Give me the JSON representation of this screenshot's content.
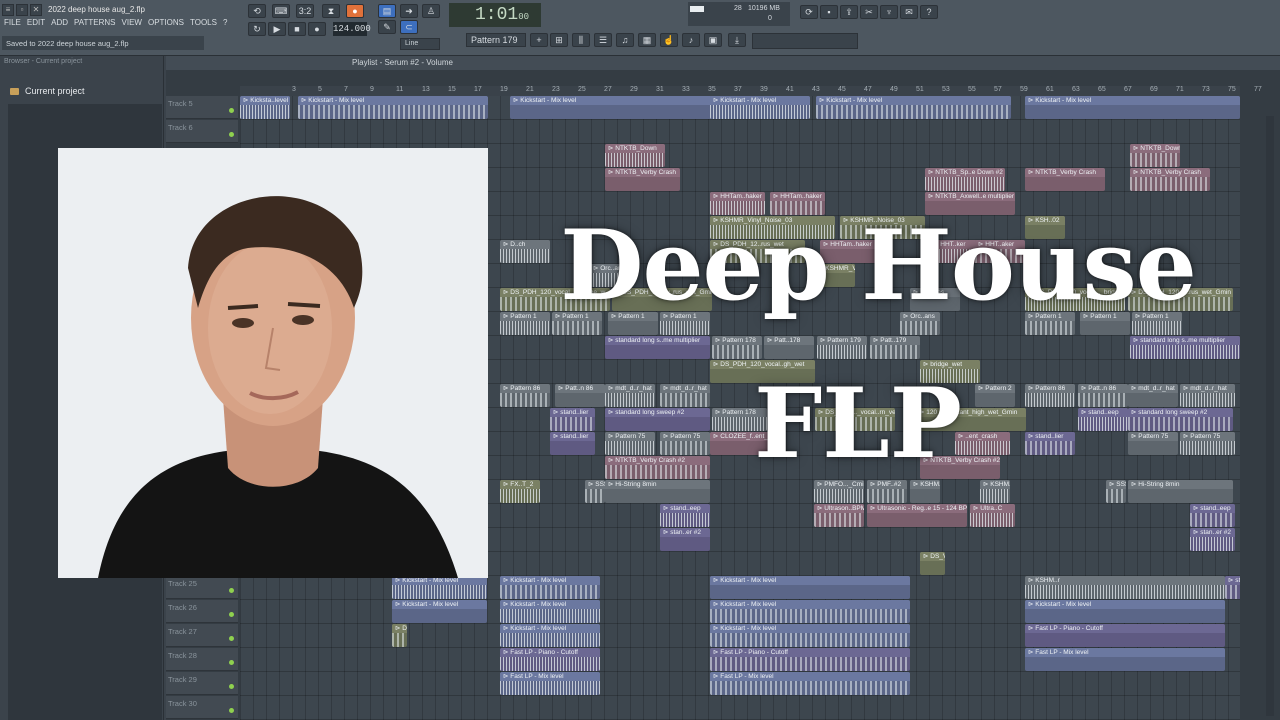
{
  "window": {
    "file_title": "2022 deep house aug_2.flp",
    "hint": "Saved to 2022 deep house aug_2.flp"
  },
  "menu": [
    "FILE",
    "EDIT",
    "ADD",
    "PATTERNS",
    "VIEW",
    "OPTIONS",
    "TOOLS",
    "?"
  ],
  "transport": {
    "time": "1:01",
    "time_sub": "00",
    "tempo": "124.000",
    "pattern": "Pattern 179",
    "snap": "Line",
    "time_sig": "3:2"
  },
  "cpu": {
    "left": "28",
    "mem": "10196 MB",
    "voices": "0"
  },
  "browser": {
    "header": "Browser - Current project",
    "item": "Current project"
  },
  "playlist": {
    "title": "Playlist - Serum #2 - Volume",
    "ruler": [
      "3",
      "5",
      "7",
      "9",
      "11",
      "13",
      "15",
      "17",
      "19",
      "21",
      "23",
      "25",
      "27",
      "29",
      "31",
      "33",
      "35",
      "37",
      "39",
      "41",
      "43",
      "45",
      "47",
      "49",
      "51",
      "53",
      "55",
      "57",
      "59",
      "61",
      "63",
      "65",
      "67",
      "69",
      "71",
      "73",
      "75",
      "77"
    ],
    "tracks_top": [
      "Track 5",
      "Track 6"
    ],
    "tracks_bottom": [
      "Track 25",
      "Track 26",
      "Track 27",
      "Track 28",
      "Track 29",
      "Track 30"
    ],
    "clips": [
      {
        "label": "Kicksta..level",
        "color": "c-blue"
      },
      {
        "label": "Kickstart - Mix level",
        "color": "c-blue"
      },
      {
        "label": "Kickstart - Mix level",
        "color": "c-blue"
      },
      {
        "label": "Kickstart - Mix level",
        "color": "c-blue"
      },
      {
        "label": "Kickstart - Mix level",
        "color": "c-blue"
      },
      {
        "label": "Kickstart - Mix level",
        "color": "c-blue"
      },
      {
        "label": "NTKTB_Down",
        "color": "c-pink"
      },
      {
        "label": "NTKTB_Down",
        "color": "c-pink"
      },
      {
        "label": "NTKTB_Verby Crash",
        "color": "c-pink"
      },
      {
        "label": "NTKTB_Sp..e Down #2",
        "color": "c-pink"
      },
      {
        "label": "NTKTB_Verby Crash",
        "color": "c-pink"
      },
      {
        "label": "NTKTB_Verby Crash",
        "color": "c-pink"
      },
      {
        "label": "HHTam..haker",
        "color": "c-pink"
      },
      {
        "label": "HHTam..haker",
        "color": "c-pink"
      },
      {
        "label": "NTKTB_Axwell..e multiplier",
        "color": "c-pink"
      },
      {
        "label": "KSHMR_Vinyl_Noise_03",
        "color": "c-olive"
      },
      {
        "label": "KSHMR..Noise_03",
        "color": "c-olive"
      },
      {
        "label": "KSH..02",
        "color": "c-olive"
      },
      {
        "label": "D..ch",
        "color": "c-gray"
      },
      {
        "label": "DS_PDH_12..rus_wet",
        "color": "c-olive"
      },
      {
        "label": "HHTam..haker",
        "color": "c-pink"
      },
      {
        "label": "HHT..ker",
        "color": "c-pink"
      },
      {
        "label": "HHT..aker",
        "color": "c-pink"
      },
      {
        "label": "KSHMR_V...",
        "color": "c-olive"
      },
      {
        "label": "Orc..ar",
        "color": "c-gray"
      },
      {
        "label": "DS_PDH_120_vocal..._bridge_w",
        "color": "c-olive"
      },
      {
        "label": "DS_PDH_120_v..rus_wet_Gmin",
        "color": "c-olive"
      },
      {
        "label": "DS_PDH_120_vocal..._bridge_w",
        "color": "c-olive"
      },
      {
        "label": "DS_PDH_120_v..rus_wet_Gmin",
        "color": "c-olive"
      },
      {
        "label": "KSH..es",
        "color": "c-gray"
      },
      {
        "label": "Pattern 1",
        "color": "c-gray"
      },
      {
        "label": "Pattern 1",
        "color": "c-gray"
      },
      {
        "label": "Pattern 1",
        "color": "c-gray"
      },
      {
        "label": "Pattern 1",
        "color": "c-gray"
      },
      {
        "label": "Pattern 1",
        "color": "c-gray"
      },
      {
        "label": "Pattern 1",
        "color": "c-gray"
      },
      {
        "label": "Pattern 1",
        "color": "c-gray"
      },
      {
        "label": "Orc..ans",
        "color": "c-gray"
      },
      {
        "label": "standard long s..me multiplier",
        "color": "c-purple"
      },
      {
        "label": "standard long s..me multiplier",
        "color": "c-purple"
      },
      {
        "label": "Pattern 178",
        "color": "c-gray"
      },
      {
        "label": "Patt..178",
        "color": "c-gray"
      },
      {
        "label": "Pattern 179",
        "color": "c-gray"
      },
      {
        "label": "Patt..179",
        "color": "c-gray"
      },
      {
        "label": "DS_PDH_120_vocal..gh_wet",
        "color": "c-olive"
      },
      {
        "label": "bridge_wet",
        "color": "c-olive"
      },
      {
        "label": "Pattern 86",
        "color": "c-gray"
      },
      {
        "label": "Patt..n 86",
        "color": "c-gray"
      },
      {
        "label": "mdt_d..r_hat",
        "color": "c-gray"
      },
      {
        "label": "mdt_d..r_hat",
        "color": "c-gray"
      },
      {
        "label": "Pattern 2",
        "color": "c-gray"
      },
      {
        "label": "Pattern 86",
        "color": "c-gray"
      },
      {
        "label": "Patt..n 86",
        "color": "c-gray"
      },
      {
        "label": "mdt_d..r_hat",
        "color": "c-gray"
      },
      {
        "label": "mdt_d..r_hat",
        "color": "c-gray"
      },
      {
        "label": "stand..lier",
        "color": "c-purple"
      },
      {
        "label": "standard long sweep #2",
        "color": "c-purple"
      },
      {
        "label": "Pattern 178",
        "color": "c-gray"
      },
      {
        "label": "DS_PDH..._vocal..rn_verse",
        "color": "c-olive"
      },
      {
        "label": "120_vocal..ant_high_wet_Gmin",
        "color": "c-olive"
      },
      {
        "label": "stand..eep",
        "color": "c-purple"
      },
      {
        "label": "standard long sweep #2",
        "color": "c-purple"
      },
      {
        "label": "stand..lier",
        "color": "c-purple"
      },
      {
        "label": "Pattern 75",
        "color": "c-gray"
      },
      {
        "label": "Pattern 75",
        "color": "c-gray"
      },
      {
        "label": "CLOZEE_f..ent_cra",
        "color": "c-pink"
      },
      {
        "label": "..ent_crash",
        "color": "c-pink"
      },
      {
        "label": "stand..lier",
        "color": "c-purple"
      },
      {
        "label": "Pattern 75",
        "color": "c-gray"
      },
      {
        "label": "Pattern 75",
        "color": "c-gray"
      },
      {
        "label": "NTKTB_Verby Crash #2",
        "color": "c-pink"
      },
      {
        "label": "NTKTB_Verby Crash #2",
        "color": "c-pink"
      },
      {
        "label": "FX..T_2",
        "color": "c-olive"
      },
      {
        "label": "SSS..",
        "color": "c-gray"
      },
      {
        "label": "Hi-String 8min",
        "color": "c-gray"
      },
      {
        "label": "PMFO..._Cmin",
        "color": "c-gray"
      },
      {
        "label": "PMF..#2",
        "color": "c-gray"
      },
      {
        "label": "KSHM..r",
        "color": "c-gray"
      },
      {
        "label": "KSHM..sic",
        "color": "c-gray"
      },
      {
        "label": "SSS..",
        "color": "c-gray"
      },
      {
        "label": "Hi-String 8min",
        "color": "c-gray"
      },
      {
        "label": "stand..eep",
        "color": "c-purple"
      },
      {
        "label": "Ultrason..BPM",
        "color": "c-pink"
      },
      {
        "label": "Ultrasonic - Reg..e 15 - 124 BPM",
        "color": "c-pink"
      },
      {
        "label": "Ultra..C",
        "color": "c-pink"
      },
      {
        "label": "stand..eep",
        "color": "c-purple"
      },
      {
        "label": "stan..er #2",
        "color": "c-purple"
      },
      {
        "label": "stan..er #2",
        "color": "c-purple"
      },
      {
        "label": "DS_V..",
        "color": "c-olive"
      },
      {
        "label": "DS_V..",
        "color": "c-olive"
      },
      {
        "label": "Kickstart - Mix level",
        "color": "c-blue"
      },
      {
        "label": "Kickstart - Mix level",
        "color": "c-blue"
      },
      {
        "label": "Kickstart - Mix level",
        "color": "c-blue"
      },
      {
        "label": "KSHM..r",
        "color": "c-gray"
      },
      {
        "label": "standard long sweep",
        "color": "c-purple"
      },
      {
        "label": "Kickstart - Mix level",
        "color": "c-blue"
      },
      {
        "label": "Kickstart - Mix level",
        "color": "c-blue"
      },
      {
        "label": "Kickstart - Mix level",
        "color": "c-blue"
      },
      {
        "label": "Kickstart - Mix level",
        "color": "c-blue"
      },
      {
        "label": "Kickstart - Mix level",
        "color": "c-blue"
      },
      {
        "label": "Kickstart - Mix level",
        "color": "c-blue"
      },
      {
        "label": "Fast LP - Piano - Cutoff",
        "color": "c-purple"
      },
      {
        "label": "Fast LP - Piano - Cutoff",
        "color": "c-purple"
      },
      {
        "label": "Fast LP - Piano - Cutoff",
        "color": "c-purple"
      },
      {
        "label": "Fast LP - Mix level",
        "color": "c-blue"
      },
      {
        "label": "Fast LP - Mix level",
        "color": "c-blue"
      },
      {
        "label": "Fast LP - Mix level",
        "color": "c-blue"
      }
    ]
  },
  "overlay": {
    "line1": "Deep House",
    "line2": "FLP"
  }
}
